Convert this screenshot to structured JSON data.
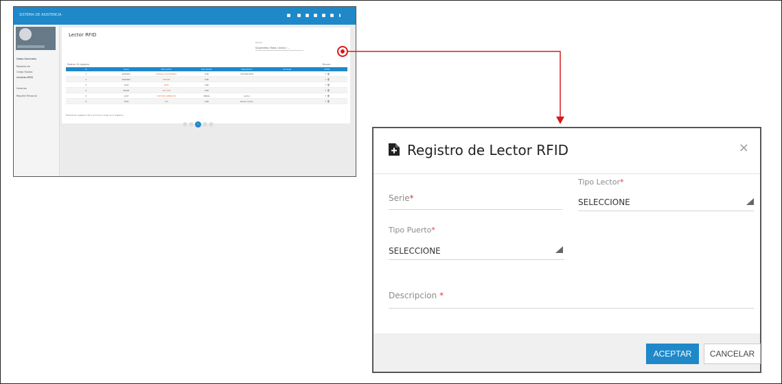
{
  "mini": {
    "app_title": "SISTEMA DE ASISTENCIA",
    "sidebar": [
      "Datos Generales",
      "Registro de",
      "Cargo Equipo",
      "Lectores RFID",
      "Horarios",
      "Reporte Personal"
    ],
    "page_title": "Lector RFID",
    "filter_label": "Estado",
    "filter_value": "Suspendido / Todos / Activo / ...",
    "show_label": "Mostrar 10 registros",
    "search_label": "Buscar:",
    "columns": [
      "#",
      "Serie",
      "Tipo Lector",
      "Tipo Puerto",
      "Descripcion",
      "Acciones",
      "Editar"
    ],
    "rows": [
      [
        "1",
        "0000001",
        "MANUAL ESCRITORIO",
        "USB",
        "LECTOR RFID",
        "",
        "✎ 🗑"
      ],
      [
        "2",
        "0000002",
        "MIFARE",
        "USB",
        "",
        "",
        "✎ 🗑"
      ],
      [
        "3",
        "1234",
        "ZKTE",
        "USB",
        "",
        "",
        "✎ 🗑"
      ],
      [
        "4",
        "00005",
        "ZK COM",
        "USB",
        "",
        "",
        "✎ 🗑"
      ],
      [
        "5",
        "1247",
        "LECTOR COMPACTO",
        "SERIAL",
        "Lector",
        "",
        "✎ 🗑"
      ],
      [
        "6",
        "1300",
        "ZKT",
        "USB",
        "Nuevo Lector",
        "",
        "✎ 🗑"
      ]
    ],
    "info": "Mostrando registros del 1 al 6 de un total de 6 registros",
    "pages": [
      "«",
      "‹",
      "1",
      "›",
      "»"
    ]
  },
  "modal": {
    "title": "Registro de Lector RFID",
    "close": "×",
    "serie_label": "Serie",
    "tipo_lector_label": "Tipo Lector",
    "tipo_lector_value": "SELECCIONE",
    "tipo_puerto_label": "Tipo Puerto",
    "tipo_puerto_value": "SELECCIONE",
    "descripcion_label": "Descripcion ",
    "required_mark": "*",
    "accept": "ACEPTAR",
    "cancel": "CANCELAR"
  },
  "colors": {
    "accent": "#1e88c9",
    "callout": "#d51a1a",
    "required": "#e53935"
  }
}
